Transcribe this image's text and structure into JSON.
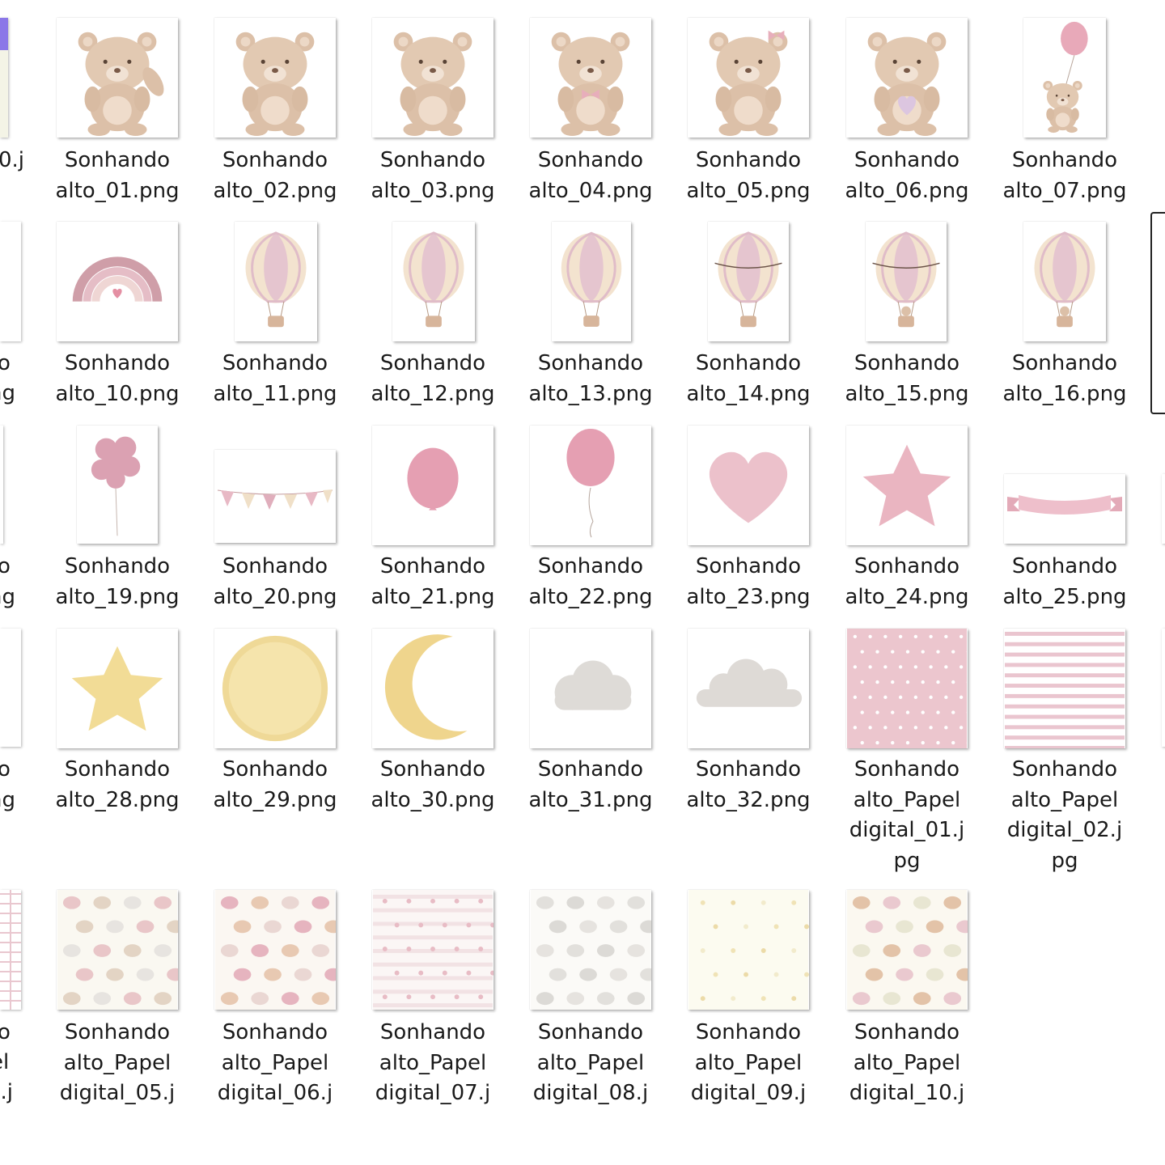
{
  "files": [
    {
      "line1": "Sonhando",
      "line2": "alto_01.png",
      "icon": "teddy-bear-waving"
    },
    {
      "line1": "Sonhando",
      "line2": "alto_02.png",
      "icon": "teddy-bear-sitting"
    },
    {
      "line1": "Sonhando",
      "line2": "alto_03.png",
      "icon": "teddy-bear-peeking"
    },
    {
      "line1": "Sonhando",
      "line2": "alto_04.png",
      "icon": "teddy-bear-bow"
    },
    {
      "line1": "Sonhando",
      "line2": "alto_05.png",
      "icon": "teddy-bear-hairbow"
    },
    {
      "line1": "Sonhando",
      "line2": "alto_06.png",
      "icon": "teddy-bear-heart"
    },
    {
      "line1": "Sonhando",
      "line2": "alto_07.png",
      "icon": "teddy-bear-balloon"
    },
    {
      "line1": "Sonhando",
      "line2": "alto_10.png",
      "icon": "rainbow-heart"
    },
    {
      "line1": "Sonhando",
      "line2": "alto_11.png",
      "icon": "hot-air-balloon"
    },
    {
      "line1": "Sonhando",
      "line2": "alto_12.png",
      "icon": "hot-air-balloon"
    },
    {
      "line1": "Sonhando",
      "line2": "alto_13.png",
      "icon": "hot-air-balloon-round"
    },
    {
      "line1": "Sonhando",
      "line2": "alto_14.png",
      "icon": "hot-air-balloon-garland"
    },
    {
      "line1": "Sonhando",
      "line2": "alto_15.png",
      "icon": "hot-air-balloon-bear"
    },
    {
      "line1": "Sonhando",
      "line2": "alto_16.png",
      "icon": "hot-air-balloon-bear-top"
    },
    {
      "line1": "Sonhando",
      "line2": "alto_19.png",
      "icon": "balloon-bunch"
    },
    {
      "line1": "Sonhando",
      "line2": "alto_20.png",
      "icon": "bunting-flags"
    },
    {
      "line1": "Sonhando",
      "line2": "alto_21.png",
      "icon": "pink-balloon"
    },
    {
      "line1": "Sonhando",
      "line2": "alto_22.png",
      "icon": "pink-balloon-string"
    },
    {
      "line1": "Sonhando",
      "line2": "alto_23.png",
      "icon": "pink-heart"
    },
    {
      "line1": "Sonhando",
      "line2": "alto_24.png",
      "icon": "pink-star"
    },
    {
      "line1": "Sonhando",
      "line2": "alto_25.png",
      "icon": "pink-ribbon-banner"
    },
    {
      "line1": "Sonhando",
      "line2": "alto_28.png",
      "icon": "yellow-star"
    },
    {
      "line1": "Sonhando",
      "line2": "alto_29.png",
      "icon": "yellow-moon-full"
    },
    {
      "line1": "Sonhando",
      "line2": "alto_30.png",
      "icon": "yellow-moon-crescent"
    },
    {
      "line1": "Sonhando",
      "line2": "alto_31.png",
      "icon": "grey-cloud"
    },
    {
      "line1": "Sonhando",
      "line2": "alto_32.png",
      "icon": "grey-cloud-wide"
    },
    {
      "line1": "Sonhando",
      "line2": "alto_Papel",
      "line3": "digital_01.j",
      "line4": "pg",
      "icon": "pink-polka-dot-paper"
    },
    {
      "line1": "Sonhando",
      "line2": "alto_Papel",
      "line3": "digital_02.j",
      "line4": "pg",
      "icon": "pink-stripe-paper"
    },
    {
      "line1": "Sonhando",
      "line2": "alto_Papel",
      "line3": "digital_05.j",
      "icon": "balloon-pattern-paper"
    },
    {
      "line1": "Sonhando",
      "line2": "alto_Papel",
      "line3": "digital_06.j",
      "icon": "balloon-bear-pattern-paper"
    },
    {
      "line1": "Sonhando",
      "line2": "alto_Papel",
      "line3": "digital_07.j",
      "icon": "heart-stripe-paper"
    },
    {
      "line1": "Sonhando",
      "line2": "alto_Papel",
      "line3": "digital_08.j",
      "icon": "cloud-pattern-paper"
    },
    {
      "line1": "Sonhando",
      "line2": "alto_Papel",
      "line3": "digital_09.j",
      "icon": "star-pattern-paper"
    },
    {
      "line1": "Sonhando",
      "line2": "alto_Papel",
      "line3": "digital_10.j",
      "icon": "bear-pattern-paper"
    }
  ],
  "left_edge": {
    "row1": "0.j",
    "row2": [
      "o",
      "ng"
    ],
    "row3": [
      "o",
      "ng"
    ],
    "row4": [
      "o",
      "ng"
    ],
    "row5": [
      "o",
      "el",
      "4.j"
    ]
  }
}
